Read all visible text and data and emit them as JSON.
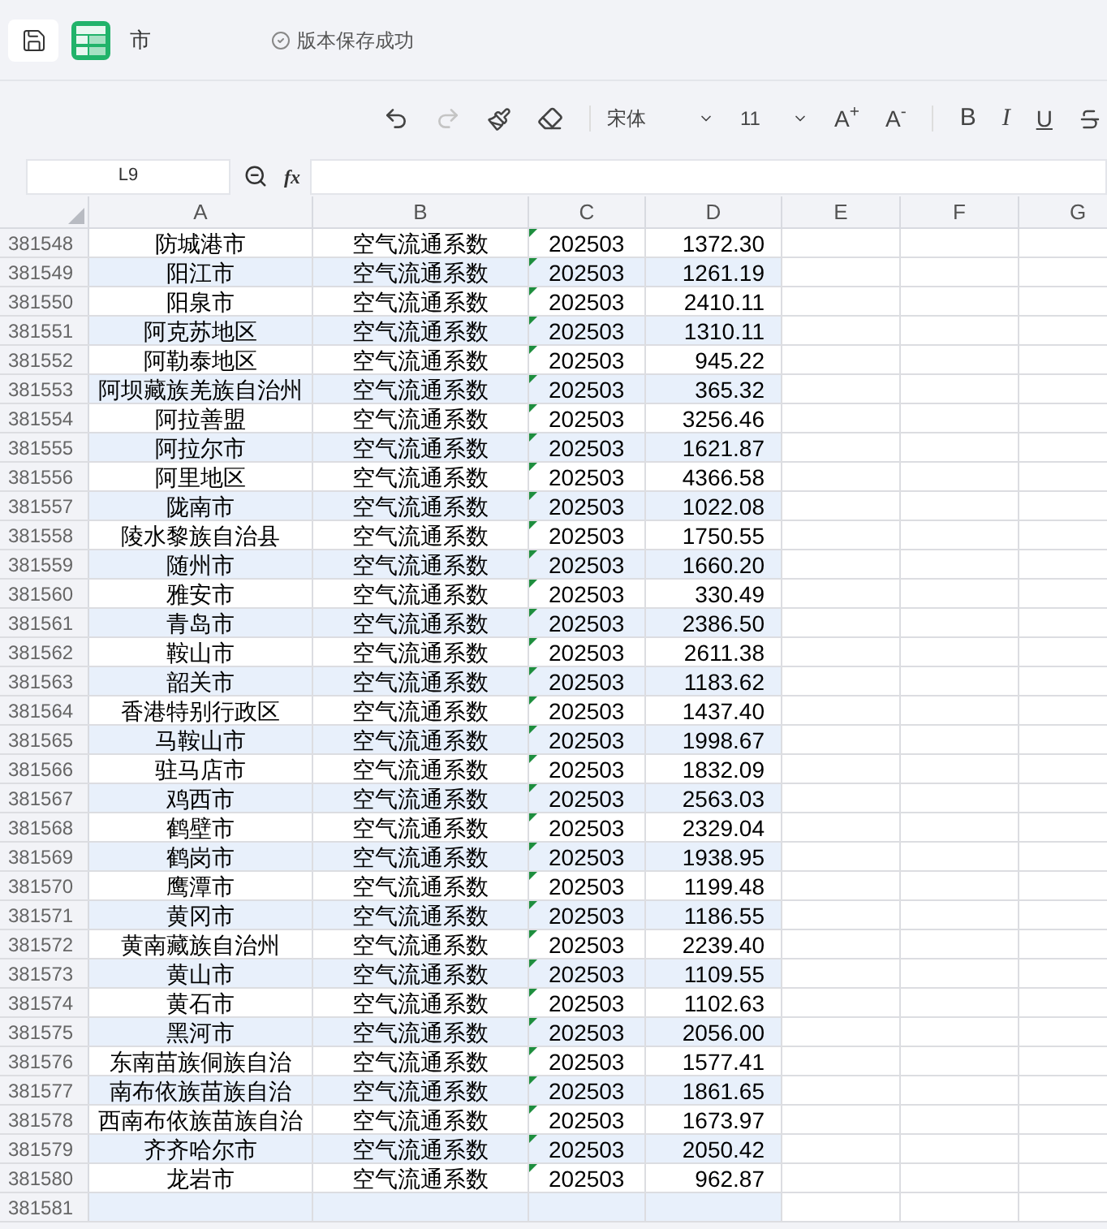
{
  "header": {
    "title": "市",
    "status": "版本保存成功"
  },
  "toolbar": {
    "undo_disabled": false,
    "redo_disabled": true,
    "font": "宋体",
    "size": "11",
    "increase": "A$^{+}$",
    "decrease": "A$^{-}$",
    "bold": "B",
    "italic": "I",
    "underline": "U"
  },
  "formula_bar": {
    "cell": "L9",
    "fx": "fx"
  },
  "columns": [
    "A",
    "B",
    "C",
    "D",
    "E",
    "F",
    "G"
  ],
  "rows": [
    {
      "n": "381548",
      "shaded": false,
      "cells": [
        "防城港市",
        "空气流通系数",
        "202503",
        "1372.30"
      ]
    },
    {
      "n": "381549",
      "shaded": true,
      "cells": [
        "阳江市",
        "空气流通系数",
        "202503",
        "1261.19"
      ]
    },
    {
      "n": "381550",
      "shaded": false,
      "cells": [
        "阳泉市",
        "空气流通系数",
        "202503",
        "2410.11"
      ]
    },
    {
      "n": "381551",
      "shaded": true,
      "cells": [
        "阿克苏地区",
        "空气流通系数",
        "202503",
        "1310.11"
      ]
    },
    {
      "n": "381552",
      "shaded": false,
      "cells": [
        "阿勒泰地区",
        "空气流通系数",
        "202503",
        "945.22"
      ]
    },
    {
      "n": "381553",
      "shaded": true,
      "cells": [
        "阿坝藏族羌族自治州",
        "空气流通系数",
        "202503",
        "365.32"
      ]
    },
    {
      "n": "381554",
      "shaded": false,
      "cells": [
        "阿拉善盟",
        "空气流通系数",
        "202503",
        "3256.46"
      ]
    },
    {
      "n": "381555",
      "shaded": true,
      "cells": [
        "阿拉尔市",
        "空气流通系数",
        "202503",
        "1621.87"
      ]
    },
    {
      "n": "381556",
      "shaded": false,
      "cells": [
        "阿里地区",
        "空气流通系数",
        "202503",
        "4366.58"
      ]
    },
    {
      "n": "381557",
      "shaded": true,
      "cells": [
        "陇南市",
        "空气流通系数",
        "202503",
        "1022.08"
      ]
    },
    {
      "n": "381558",
      "shaded": false,
      "cells": [
        "陵水黎族自治县",
        "空气流通系数",
        "202503",
        "1750.55"
      ]
    },
    {
      "n": "381559",
      "shaded": true,
      "cells": [
        "随州市",
        "空气流通系数",
        "202503",
        "1660.20"
      ]
    },
    {
      "n": "381560",
      "shaded": false,
      "cells": [
        "雅安市",
        "空气流通系数",
        "202503",
        "330.49"
      ]
    },
    {
      "n": "381561",
      "shaded": true,
      "cells": [
        "青岛市",
        "空气流通系数",
        "202503",
        "2386.50"
      ]
    },
    {
      "n": "381562",
      "shaded": false,
      "cells": [
        "鞍山市",
        "空气流通系数",
        "202503",
        "2611.38"
      ]
    },
    {
      "n": "381563",
      "shaded": true,
      "cells": [
        "韶关市",
        "空气流通系数",
        "202503",
        "1183.62"
      ]
    },
    {
      "n": "381564",
      "shaded": false,
      "cells": [
        "香港特别行政区",
        "空气流通系数",
        "202503",
        "1437.40"
      ]
    },
    {
      "n": "381565",
      "shaded": true,
      "cells": [
        "马鞍山市",
        "空气流通系数",
        "202503",
        "1998.67"
      ]
    },
    {
      "n": "381566",
      "shaded": false,
      "cells": [
        "驻马店市",
        "空气流通系数",
        "202503",
        "1832.09"
      ]
    },
    {
      "n": "381567",
      "shaded": true,
      "cells": [
        "鸡西市",
        "空气流通系数",
        "202503",
        "2563.03"
      ]
    },
    {
      "n": "381568",
      "shaded": false,
      "cells": [
        "鹤壁市",
        "空气流通系数",
        "202503",
        "2329.04"
      ]
    },
    {
      "n": "381569",
      "shaded": true,
      "cells": [
        "鹤岗市",
        "空气流通系数",
        "202503",
        "1938.95"
      ]
    },
    {
      "n": "381570",
      "shaded": false,
      "cells": [
        "鹰潭市",
        "空气流通系数",
        "202503",
        "1199.48"
      ]
    },
    {
      "n": "381571",
      "shaded": true,
      "cells": [
        "黄冈市",
        "空气流通系数",
        "202503",
        "1186.55"
      ]
    },
    {
      "n": "381572",
      "shaded": false,
      "cells": [
        "黄南藏族自治州",
        "空气流通系数",
        "202503",
        "2239.40"
      ]
    },
    {
      "n": "381573",
      "shaded": true,
      "cells": [
        "黄山市",
        "空气流通系数",
        "202503",
        "1109.55"
      ]
    },
    {
      "n": "381574",
      "shaded": false,
      "cells": [
        "黄石市",
        "空气流通系数",
        "202503",
        "1102.63"
      ]
    },
    {
      "n": "381575",
      "shaded": true,
      "cells": [
        "黑河市",
        "空气流通系数",
        "202503",
        "2056.00"
      ]
    },
    {
      "n": "381576",
      "shaded": false,
      "cells": [
        "东南苗族侗族自治",
        "空气流通系数",
        "202503",
        "1577.41"
      ]
    },
    {
      "n": "381577",
      "shaded": true,
      "cells": [
        "南布依族苗族自治",
        "空气流通系数",
        "202503",
        "1861.65"
      ]
    },
    {
      "n": "381578",
      "shaded": false,
      "cells": [
        "西南布依族苗族自治",
        "空气流通系数",
        "202503",
        "1673.97"
      ]
    },
    {
      "n": "381579",
      "shaded": true,
      "cells": [
        "齐齐哈尔市",
        "空气流通系数",
        "202503",
        "2050.42"
      ]
    },
    {
      "n": "381580",
      "shaded": false,
      "cells": [
        "龙岩市",
        "空气流通系数",
        "202503",
        "962.87"
      ]
    },
    {
      "n": "381581",
      "shaded": true,
      "cells": []
    }
  ]
}
